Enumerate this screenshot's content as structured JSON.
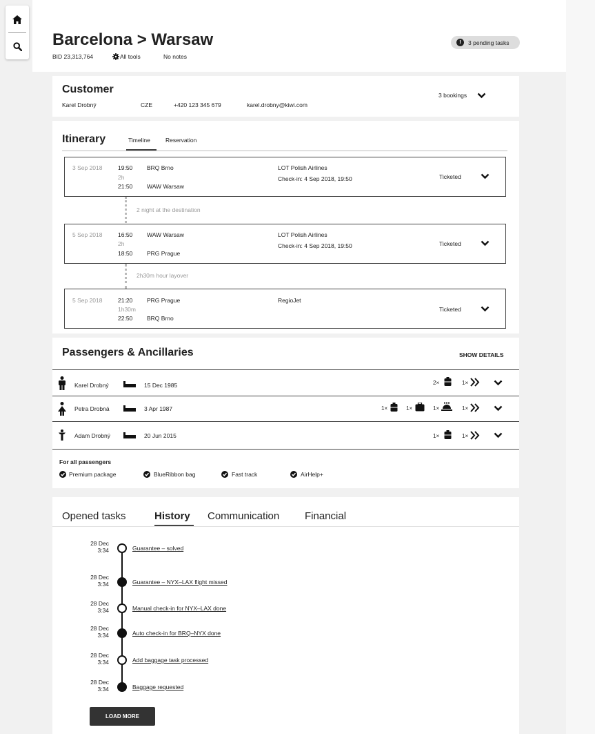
{
  "header": {
    "title": "Barcelona > Warsaw",
    "bid": "BID 23,313,764",
    "all_tools": "All tools",
    "notes": "No notes",
    "pending": "3 pending tasks"
  },
  "customer": {
    "heading": "Customer",
    "name": "Karel Drobný",
    "country": "CZE",
    "phone": "+420 123 345 679",
    "email": "karel.drobny@kiwi.com",
    "bookings": "3 bookings"
  },
  "itinerary": {
    "heading": "Itinerary",
    "tabs": [
      "Timeline",
      "Reservation"
    ],
    "segments": [
      {
        "date": "3 Sep 2018",
        "dep_time": "19:50",
        "dep_place": "BRQ Brno",
        "duration": "2h",
        "arr_time": "21:50",
        "arr_place": "WAW Warsaw",
        "carrier": "LOT Polish Airlines",
        "checkin": "Check-in: 4 Sep 2018, 19:50",
        "status": "Ticketed"
      },
      {
        "date": "5 Sep 2018",
        "dep_time": "16:50",
        "dep_place": "WAW Warsaw",
        "duration": "2h",
        "arr_time": "18:50",
        "arr_place": "PRG Prague",
        "carrier": "LOT Polish Airlines",
        "checkin": "Check-in: 4 Sep 2018, 19:50",
        "status": "Ticketed"
      },
      {
        "date": "5 Sep 2018",
        "dep_time": "21:20",
        "dep_place": "PRG Prague",
        "duration": "1h30m",
        "arr_time": "22:50",
        "arr_place": "BRQ Brno",
        "carrier": "RegioJet",
        "checkin": "",
        "status": "Ticketed"
      }
    ],
    "gaps": [
      "2 night at the destination",
      "2h30m hour layover"
    ]
  },
  "passengers": {
    "heading": "Passengers & Ancillaries",
    "show_details": "SHOW DETAILS",
    "list": [
      {
        "name": "Karel Drobný",
        "dob": "15 Dec 1985",
        "icon": "man-icon",
        "cabin": "2×",
        "priority": "1×"
      },
      {
        "name": "Petra Drobná",
        "dob": "3 Apr 1987",
        "icon": "woman-icon",
        "cabin": "1×",
        "checked": "1×",
        "meal": "1×",
        "priority": "1×"
      },
      {
        "name": "Adam Drobný",
        "dob": "20 Jun 2015",
        "icon": "child-icon",
        "cabin": "1×",
        "priority": "1×"
      }
    ],
    "all_label": "For all passengers",
    "all_items": [
      "Premium package",
      "BlueRibbon bag",
      "Fast track",
      "AirHelp+"
    ]
  },
  "tasks": {
    "tabs": [
      "Opened tasks",
      "History",
      "Communication",
      "Financial"
    ],
    "active_tab": "History",
    "history": [
      {
        "date": "28 Dec",
        "time": "3:34",
        "label": "Guarantee – solved",
        "filled": false
      },
      {
        "date": "28 Dec",
        "time": "3:34",
        "label": "Guarantee – NYX–LAX flight missed",
        "filled": true
      },
      {
        "date": "28 Dec",
        "time": "3:34",
        "label": "Manual check-in for NYX–LAX done",
        "filled": false
      },
      {
        "date": "28 Dec",
        "time": "3:34",
        "label": "Auto check-in for BRQ–NYX done",
        "filled": true
      },
      {
        "date": "28 Dec",
        "time": "3:34",
        "label": "Add baggage task processed",
        "filled": false
      },
      {
        "date": "28 Dec",
        "time": "3:34",
        "label": "Baggage requested",
        "filled": true
      }
    ],
    "load_more": "LOAD MORE"
  }
}
